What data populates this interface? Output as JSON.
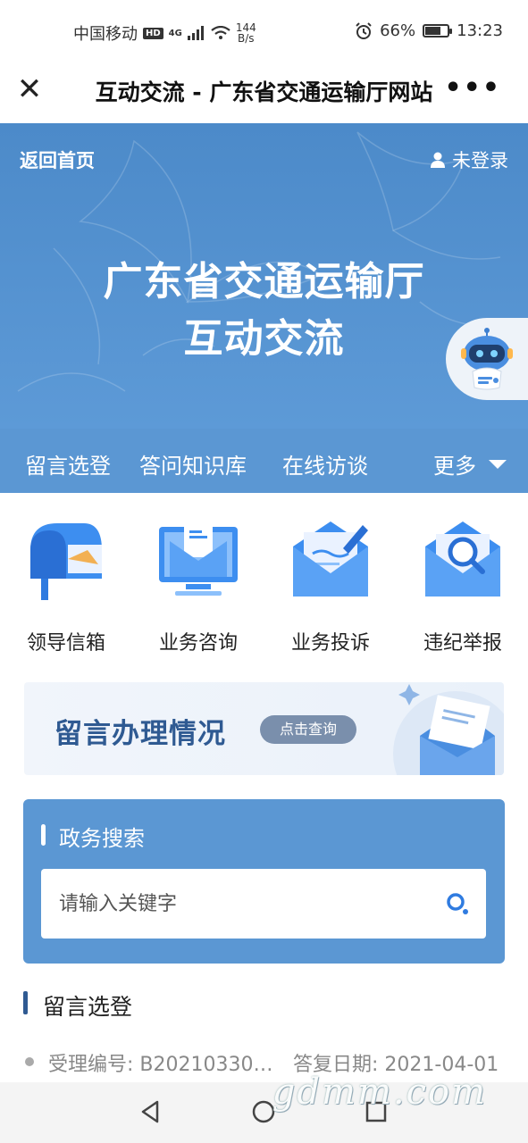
{
  "status_bar": {
    "carrier": "中国移动",
    "hd": "HD",
    "network": "4G",
    "speed_value": "144",
    "speed_unit": "B/s",
    "battery": "66%",
    "battery_level": 0.66,
    "time": "13:23"
  },
  "titlebar": {
    "title": "互动交流 - 广东省交通运输厅网站",
    "close_icon": "close-icon",
    "more_icon": "more-dots-icon"
  },
  "banner": {
    "back_home": "返回首页",
    "login": "未登录",
    "heading_line1": "广东省交通运输厅",
    "heading_line2": "互动交流",
    "robot_icon": "robot-assistant-icon"
  },
  "nav": {
    "items": [
      "留言选登",
      "答问知识库",
      "在线访谈"
    ],
    "more": "更多"
  },
  "quick_links": [
    {
      "label": "领导信箱",
      "icon": "mailbox-icon"
    },
    {
      "label": "业务咨询",
      "icon": "monitor-mail-icon"
    },
    {
      "label": "业务投诉",
      "icon": "envelope-pen-icon"
    },
    {
      "label": "违纪举报",
      "icon": "envelope-search-icon"
    }
  ],
  "message_status": {
    "title": "留言办理情况",
    "button": "点击查询"
  },
  "search": {
    "title": "政务搜索",
    "placeholder": "请输入关键字"
  },
  "section": {
    "title": "留言选登",
    "rows": [
      {
        "id": "受理编号: B20210330…",
        "date": "答复日期: 2021-04-01"
      }
    ]
  },
  "watermark": "gdmm.com",
  "colors": {
    "brand_blue": "#5b97d3",
    "dark_blue": "#2f5a92"
  }
}
